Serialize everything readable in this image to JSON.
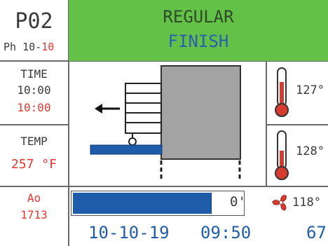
{
  "program": {
    "code": "P02",
    "phase_prefix": "Ph 10-",
    "phase_current": "10"
  },
  "header": {
    "mode": "REGULAR",
    "status": "FINISH"
  },
  "time": {
    "label": "TIME",
    "set": "10:00",
    "actual": "10:00"
  },
  "temp": {
    "label": "TEMP",
    "value": "257 °F"
  },
  "ao": {
    "label": "Ao",
    "value": "1713"
  },
  "progress": {
    "value_label": "0'",
    "fraction": 0.82
  },
  "sensors": {
    "top": {
      "icon": "thermometer-icon",
      "value": "127°"
    },
    "middle": {
      "icon": "thermometer-icon",
      "value": "128°"
    },
    "bottom": {
      "icon": "fan-icon",
      "value": "118°"
    }
  },
  "footer": {
    "date": "10-10-19",
    "clock": "09:50",
    "extra": "67"
  },
  "colors": {
    "header_bg": "#62c146",
    "accent_red": "#e8362e",
    "accent_blue": "#1f5ea8",
    "bar_blue": "#1e5caa"
  }
}
